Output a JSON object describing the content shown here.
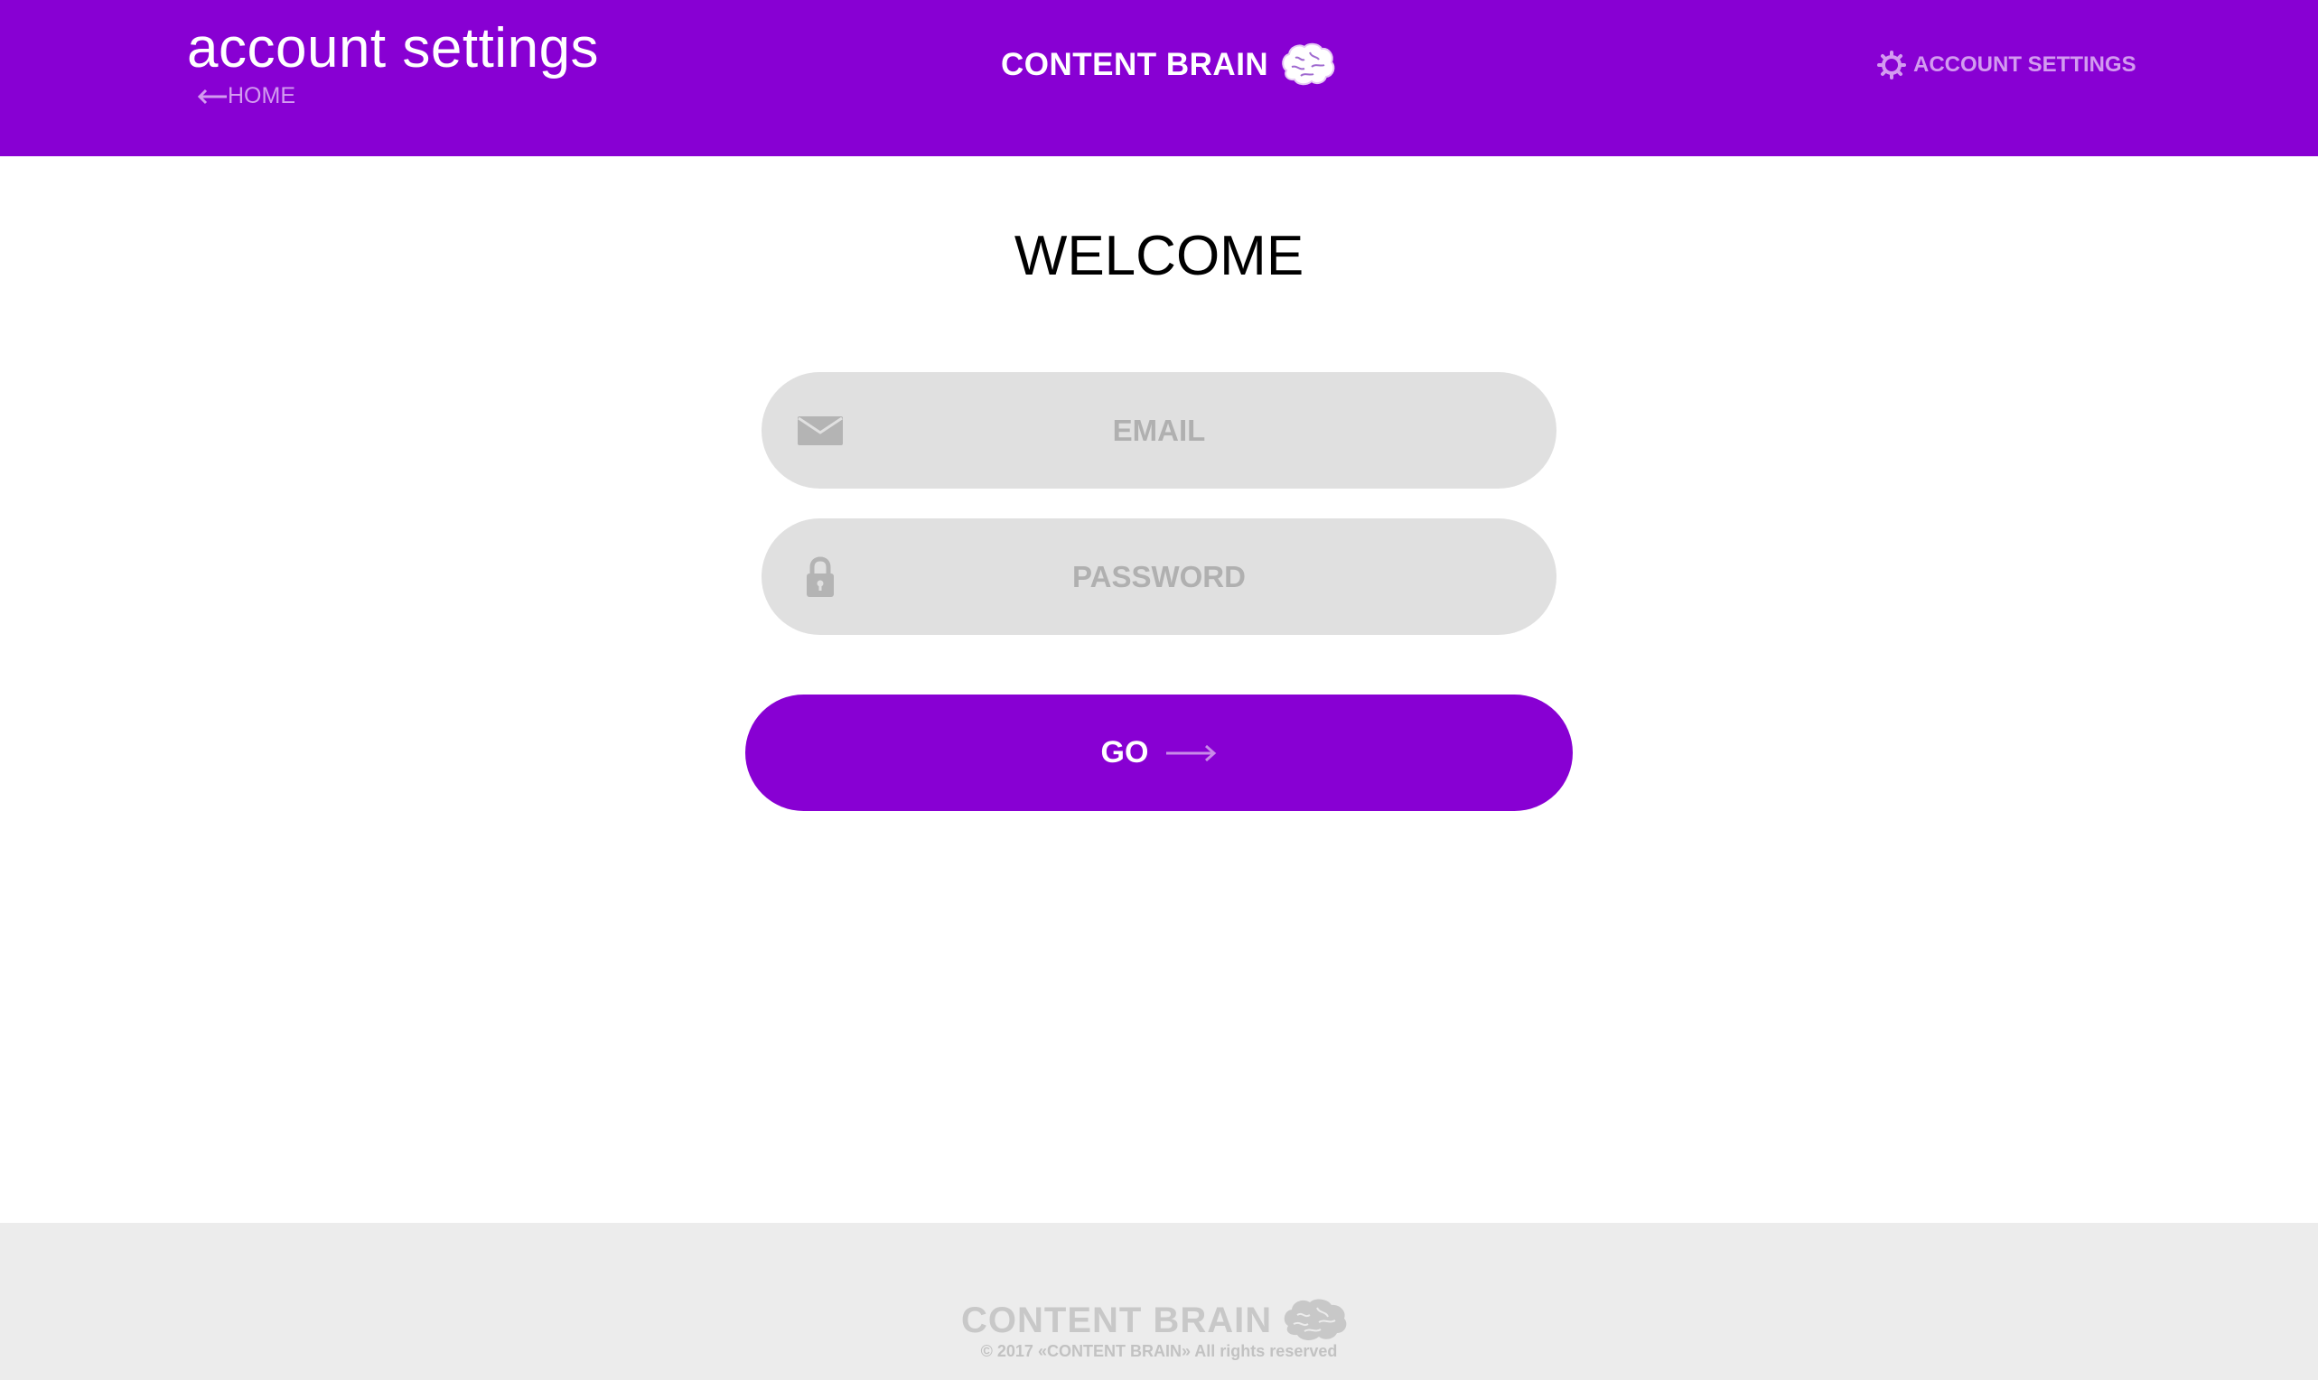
{
  "header": {
    "title": "account settings",
    "home_label": "HOME",
    "brand": "CONTENT BRAIN",
    "settings_label": "ACCOUNT SETTINGS",
    "background_color": "#8800d3"
  },
  "main": {
    "welcome": "WELCOME",
    "email": {
      "placeholder": "EMAIL",
      "value": "",
      "icon": "envelope-icon"
    },
    "password": {
      "placeholder": "PASSWORD",
      "value": "",
      "icon": "lock-icon"
    },
    "go_label": "GO"
  },
  "footer": {
    "brand": "CONTENT BRAIN",
    "copyright": "© 2017 «CONTENT BRAIN» All rights reserved"
  },
  "colors": {
    "accent": "#8800d3",
    "field_bg": "#e0e0e0",
    "footer_bg": "#ececec"
  }
}
